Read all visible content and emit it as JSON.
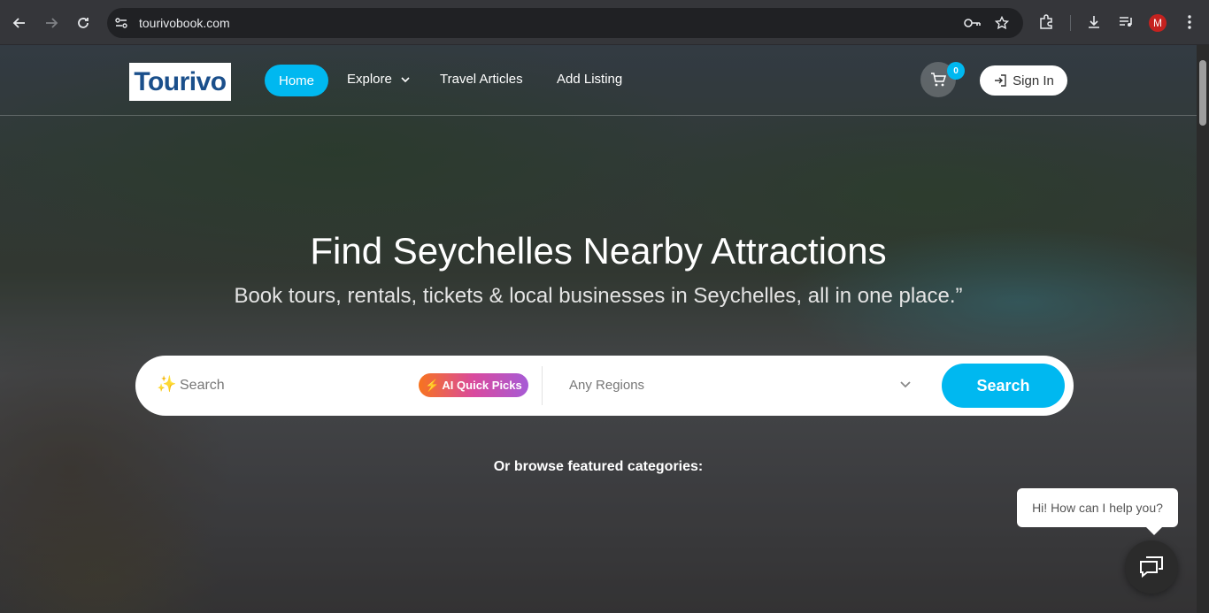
{
  "browser": {
    "url": "tourivobook.com",
    "profile_initial": "M"
  },
  "header": {
    "logo_text": "Tourivo",
    "nav": {
      "home": "Home",
      "explore": "Explore",
      "travel_articles": "Travel Articles",
      "add_listing": "Add Listing"
    },
    "cart_count": "0",
    "sign_in": "Sign In"
  },
  "hero": {
    "title": "Find Seychelles Nearby Attractions",
    "subtitle": "Book tours, rentals, tickets & local businesses in Seychelles, all in one place.”"
  },
  "search": {
    "placeholder": "Search",
    "ai_button": "AI Quick Picks",
    "region_placeholder": "Any Regions",
    "button": "Search"
  },
  "browse_text": "Or browse featured categories:",
  "chat": {
    "bubble": "Hi! How can I help you?"
  },
  "colors": {
    "accent": "#00b8f0",
    "logo_blue": "#1a4f8b",
    "chrome_bg": "#35363a"
  }
}
